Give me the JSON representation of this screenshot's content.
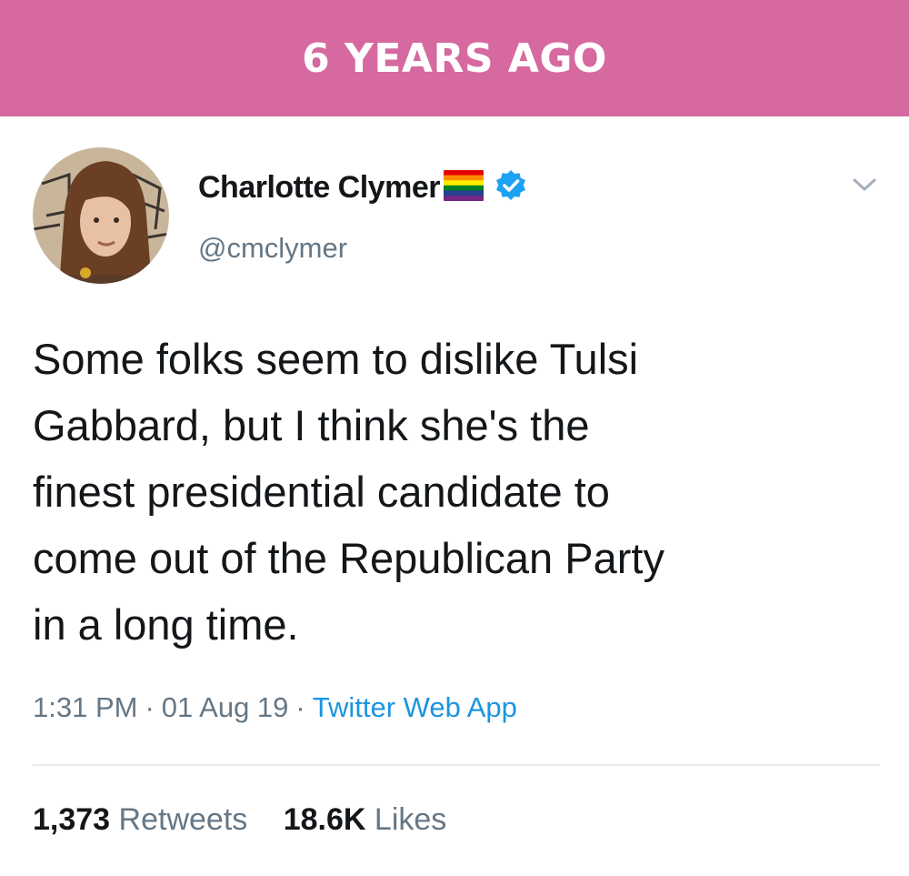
{
  "banner": {
    "text": "6 YEARS AGO",
    "color": "#d6699f"
  },
  "tweet": {
    "author": {
      "display_name": "Charlotte Clymer",
      "handle": "@cmclymer",
      "flag": "rainbow-flag-emoji",
      "verified": true
    },
    "lines": [
      "Some folks seem to dislike Tulsi",
      "Gabbard, but I think she's the",
      "finest presidential candidate to",
      "come out of the Republican Party",
      "in a long time."
    ],
    "time": "1:31 PM",
    "date": "01 Aug 19",
    "source": "Twitter Web App",
    "separator": "·",
    "retweets": {
      "count": "1,373",
      "label": "Retweets"
    },
    "likes": {
      "count": "18.6K",
      "label": "Likes"
    }
  },
  "colors": {
    "text": "#14171a",
    "muted": "#657786",
    "link": "#1b95e0",
    "verified": "#1da1f2"
  }
}
